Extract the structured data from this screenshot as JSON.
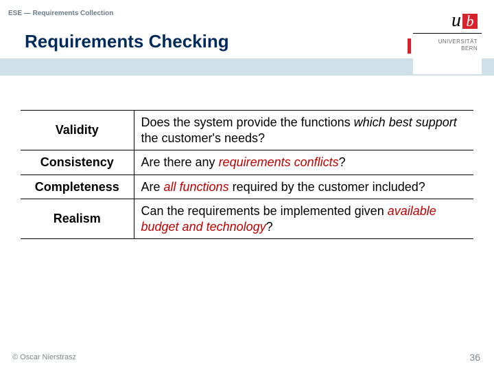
{
  "header": {
    "breadcrumb": "ESE — Requirements Collection",
    "title": "Requirements Checking",
    "logo": {
      "u": "u",
      "b": "b",
      "line1": "UNIVERSITÄT",
      "line2": "BERN"
    }
  },
  "table": [
    {
      "term": "Validity",
      "desc_pre": "Does the system provide the functions ",
      "desc_em": "which best support",
      "desc_post": " the customer's needs?",
      "em_class": "em-plain"
    },
    {
      "term": "Consistency",
      "desc_pre": "Are there any ",
      "desc_em": "requirements conflicts",
      "desc_post": "?",
      "em_class": "em-red"
    },
    {
      "term": "Completeness",
      "desc_pre": "Are ",
      "desc_em": "all functions",
      "desc_post": " required by the customer included?",
      "em_class": "em-red"
    },
    {
      "term": "Realism",
      "desc_pre": "Can the requirements be implemented given ",
      "desc_em": "available budget and technology",
      "desc_post": "?",
      "em_class": "em-red"
    }
  ],
  "footer": {
    "left": "© Oscar Nierstrasz",
    "right": "36"
  }
}
